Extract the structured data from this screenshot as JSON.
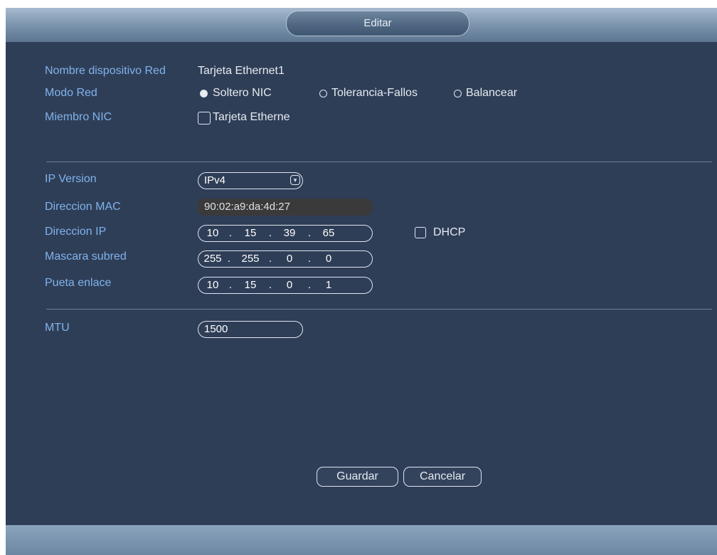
{
  "dialog": {
    "title": "Editar"
  },
  "network": {
    "device_name_label": "Nombre dispositivo Red",
    "device_name_value": "Tarjeta Ethernet1",
    "mode_label": "Modo Red",
    "mode_options": [
      {
        "label": "Soltero NIC",
        "selected": true
      },
      {
        "label": "Tolerancia-Fallos",
        "selected": false
      },
      {
        "label": "Balancear",
        "selected": false
      }
    ],
    "member_label": "Miembro NIC",
    "member_option": {
      "label": "Tarjeta Etherne",
      "checked": false
    }
  },
  "ip": {
    "version_label": "IP Version",
    "version_value": "IPv4",
    "mac_label": "Direccion MAC",
    "mac_value": "90:02:a9:da:4d:27",
    "address_label": "Direccion IP",
    "address": [
      "10",
      "15",
      "39",
      "65"
    ],
    "dhcp_label": "DHCP",
    "dhcp_checked": false,
    "subnet_label": "Mascara subred",
    "subnet": [
      "255",
      "255",
      "0",
      "0"
    ],
    "gateway_label": "Pueta enlace",
    "gateway": [
      "10",
      "15",
      "0",
      "1"
    ],
    "separator": "."
  },
  "mtu": {
    "label": "MTU",
    "value": "1500"
  },
  "buttons": {
    "save": "Guardar",
    "cancel": "Cancelar"
  }
}
